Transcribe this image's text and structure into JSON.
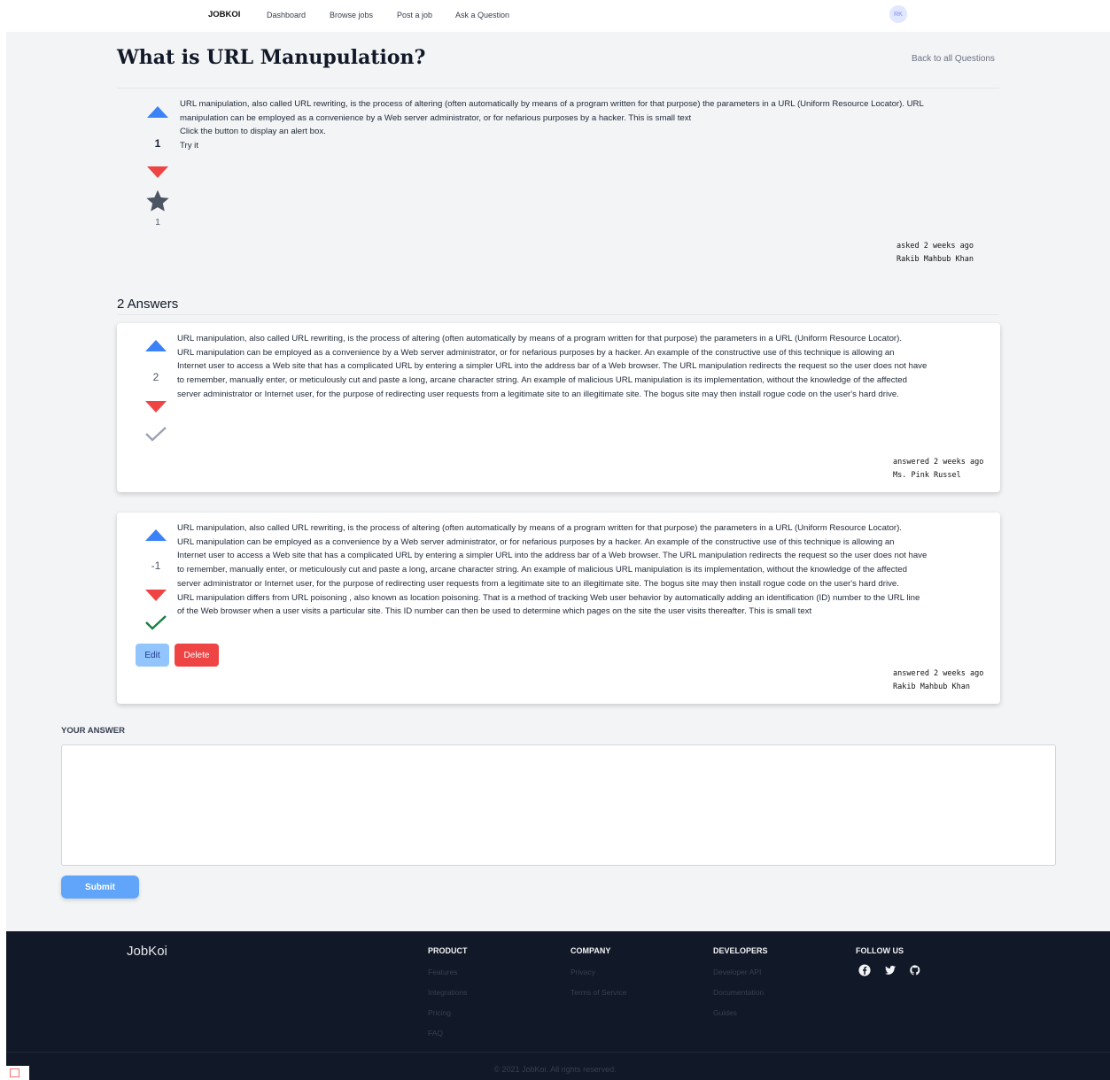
{
  "nav": {
    "brand": "JOBKOI",
    "links": [
      "Dashboard",
      "Browse jobs",
      "Post a job",
      "Ask a Question"
    ],
    "avatar_initials": "RK"
  },
  "question": {
    "title": "What is URL Manupulation?",
    "back_link": "Back to all Questions",
    "body_lines": [
      "URL manipulation, also called URL rewriting, is the process of altering (often automatically by means of a program written for that purpose) the parameters in a URL (Uniform Resource Locator). URL",
      "manipulation can be employed as a convenience by a Web server administrator, or for nefarious purposes by a hacker. This is small text",
      "Click the button to display an alert box.",
      "Try it"
    ],
    "votes": "1",
    "stars": "1",
    "asked": "asked 2 weeks ago",
    "author": "Rakib Mahbub Khan"
  },
  "answers_title": "2 Answers",
  "answers": [
    {
      "votes": "2",
      "accepted": false,
      "body_lines": [
        "URL manipulation, also called URL rewriting, is the process of altering (often automatically by means of a program written for that purpose) the parameters in a URL (Uniform Resource Locator).",
        "URL manipulation can be employed as a convenience by a Web server administrator, or for nefarious purposes by a hacker. An example of the constructive use of this technique is allowing an",
        "Internet user to access a Web site that has a complicated URL by entering a simpler URL into the address bar of a Web browser. The URL manipulation redirects the request so the user does not have",
        "to remember, manually enter, or meticulously cut and paste a long, arcane character string. An example of malicious URL manipulation is its implementation, without the knowledge of the affected",
        "server administrator or Internet user, for the purpose of redirecting user requests from a legitimate site to an illegitimate site. The bogus site may then install rogue code on the user's hard drive."
      ],
      "answered": "answered 2 weeks ago",
      "author": "Ms. Pink Russel"
    },
    {
      "votes": "-1",
      "accepted": true,
      "body_lines": [
        "URL manipulation, also called URL rewriting, is the process of altering (often automatically by means of a program written for that purpose) the parameters in a URL (Uniform Resource Locator).",
        "URL manipulation can be employed as a convenience by a Web server administrator, or for nefarious purposes by a hacker. An example of the constructive use of this technique is allowing an",
        "Internet user to access a Web site that has a complicated URL by entering a simpler URL into the address bar of a Web browser. The URL manipulation redirects the request so the user does not have",
        "to remember, manually enter, or meticulously cut and paste a long, arcane character string. An example of malicious URL manipulation is its implementation, without the knowledge of the affected",
        "server administrator or Internet user, for the purpose of redirecting user requests from a legitimate site to an illegitimate site. The bogus site may then install rogue code on the user's hard drive.",
        "URL manipulation differs from URL poisoning , also known as location poisoning. That is a method of tracking Web user behavior by automatically adding an identification (ID) number to the URL line",
        "of the Web browser when a user visits a particular site. This ID number can then be used to determine which pages on the site the user visits thereafter. This is small text"
      ],
      "edit_label": "Edit",
      "delete_label": "Delete",
      "answered": "answered 2 weeks ago",
      "author": "Rakib Mahbub Khan"
    }
  ],
  "form": {
    "label": "YOUR ANSWER",
    "value": "",
    "submit_label": "Submit"
  },
  "footer": {
    "brand": "JobKoi",
    "columns": [
      {
        "heading": "PRODUCT",
        "links": [
          "Features",
          "Integrations",
          "Pricing",
          "FAQ"
        ]
      },
      {
        "heading": "COMPANY",
        "links": [
          "Privacy",
          "Terms of Service"
        ]
      },
      {
        "heading": "DEVELOPERS",
        "links": [
          "Developer API",
          "Documentation",
          "Guides"
        ]
      },
      {
        "heading": "FOLLOW US",
        "icons": [
          "facebook-icon",
          "twitter-icon",
          "github-icon"
        ]
      }
    ],
    "copyright": "© 2021 JobKoi. All rights reserved."
  },
  "colors": {
    "upvote": "#3b82f6",
    "downvote": "#ef4444",
    "accepted_check": "#15803d",
    "unaccepted_check": "#9ca3af",
    "footer_bg": "#111827"
  }
}
